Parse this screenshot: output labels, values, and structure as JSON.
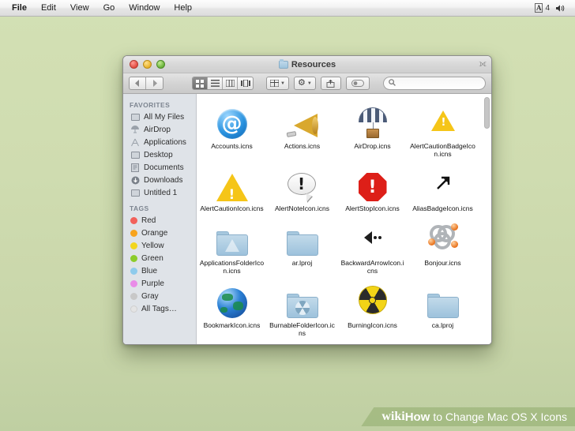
{
  "menubar": {
    "items": [
      {
        "label": "File",
        "bold": true
      },
      {
        "label": "Edit",
        "bold": false
      },
      {
        "label": "View",
        "bold": false
      },
      {
        "label": "Go",
        "bold": false
      },
      {
        "label": "Window",
        "bold": false
      },
      {
        "label": "Help",
        "bold": false
      }
    ],
    "status": {
      "input_source": "A",
      "input_number": "4",
      "volume_icon": "volume-icon"
    }
  },
  "window": {
    "title": "Resources",
    "traffic_lights": [
      "close",
      "minimize",
      "zoom"
    ],
    "toolbar": {
      "back": "◀",
      "forward": "▶",
      "view_modes": [
        {
          "name": "icon-view",
          "glyph": "▒",
          "selected": true
        },
        {
          "name": "list-view",
          "glyph": "☰",
          "selected": false
        },
        {
          "name": "column-view",
          "glyph": "▒",
          "selected": false
        },
        {
          "name": "coverflow-view",
          "glyph": "▒",
          "selected": false
        }
      ],
      "arrange_label": "▒",
      "action_label": "⚙",
      "share_label": "⤴",
      "tag_label": "⬭"
    },
    "search": {
      "placeholder": "",
      "value": "",
      "icon": "search-icon"
    }
  },
  "sidebar": {
    "sections": [
      {
        "title": "FAVORITES",
        "items": [
          {
            "label": "All My Files",
            "icon": "all-my-files-icon"
          },
          {
            "label": "AirDrop",
            "icon": "airdrop-icon"
          },
          {
            "label": "Applications",
            "icon": "applications-icon"
          },
          {
            "label": "Desktop",
            "icon": "desktop-icon"
          },
          {
            "label": "Documents",
            "icon": "documents-icon"
          },
          {
            "label": "Downloads",
            "icon": "downloads-icon"
          },
          {
            "label": "Untitled 1",
            "icon": "disk-icon"
          }
        ]
      },
      {
        "title": "TAGS",
        "items": [
          {
            "label": "Red",
            "color": "#f2615b"
          },
          {
            "label": "Orange",
            "color": "#f7a31d"
          },
          {
            "label": "Yellow",
            "color": "#f2d61e"
          },
          {
            "label": "Green",
            "color": "#8ccc2b"
          },
          {
            "label": "Blue",
            "color": "#8ecbec"
          },
          {
            "label": "Purple",
            "color": "#e98ce8"
          },
          {
            "label": "Gray",
            "color": "#c8c8c8"
          },
          {
            "label": "All Tags…",
            "color": "#dcdcdc"
          }
        ]
      }
    ]
  },
  "files": {
    "rows": [
      [
        {
          "name": "Accounts.icns",
          "icon": "at-sign-blue-circle-icon"
        },
        {
          "name": "Actions.icns",
          "icon": "megaphone-icon"
        },
        {
          "name": "AirDrop.icns",
          "icon": "parachute-icon"
        },
        {
          "name": "AlertCautionBadgeIcon.icns",
          "icon": "yellow-warning-triangle-icon"
        }
      ],
      [
        {
          "name": "AlertCautionIcon.icns",
          "icon": "yellow-warning-triangle-icon"
        },
        {
          "name": "AlertNoteIcon.icns",
          "icon": "speech-bubble-exclamation-icon"
        },
        {
          "name": "AlertStopIcon.icns",
          "icon": "red-stop-octagon-icon"
        },
        {
          "name": "AliasBadgeIcon.icns",
          "icon": "alias-arrow-icon"
        }
      ],
      [
        {
          "name": "ApplicationsFolderIcon.icns",
          "icon": "applications-folder-icon"
        },
        {
          "name": "ar.lproj",
          "icon": "folder-icon"
        },
        {
          "name": "BackwardArrowIcon.icns",
          "icon": "backward-arrow-icon"
        },
        {
          "name": "Bonjour.icns",
          "icon": "bonjour-rings-icon"
        }
      ],
      [
        {
          "name": "BookmarkIcon.icns",
          "icon": "globe-icon"
        },
        {
          "name": "BurnableFolderIcon.icns",
          "icon": "burnable-folder-icon"
        },
        {
          "name": "BurningIcon.icns",
          "icon": "burning-radiation-icon"
        },
        {
          "name": "ca.lproj",
          "icon": "folder-icon"
        }
      ]
    ]
  },
  "watermark": {
    "wiki": "wiki",
    "how": "How",
    "rest": "to Change Mac OS X Icons"
  },
  "colors": {
    "desktop_top": "#d3e0b4",
    "desktop_bottom": "#bfcfa2",
    "sidebar_bg": "#dfe3e8",
    "accent_blue": "#2a93e0"
  }
}
